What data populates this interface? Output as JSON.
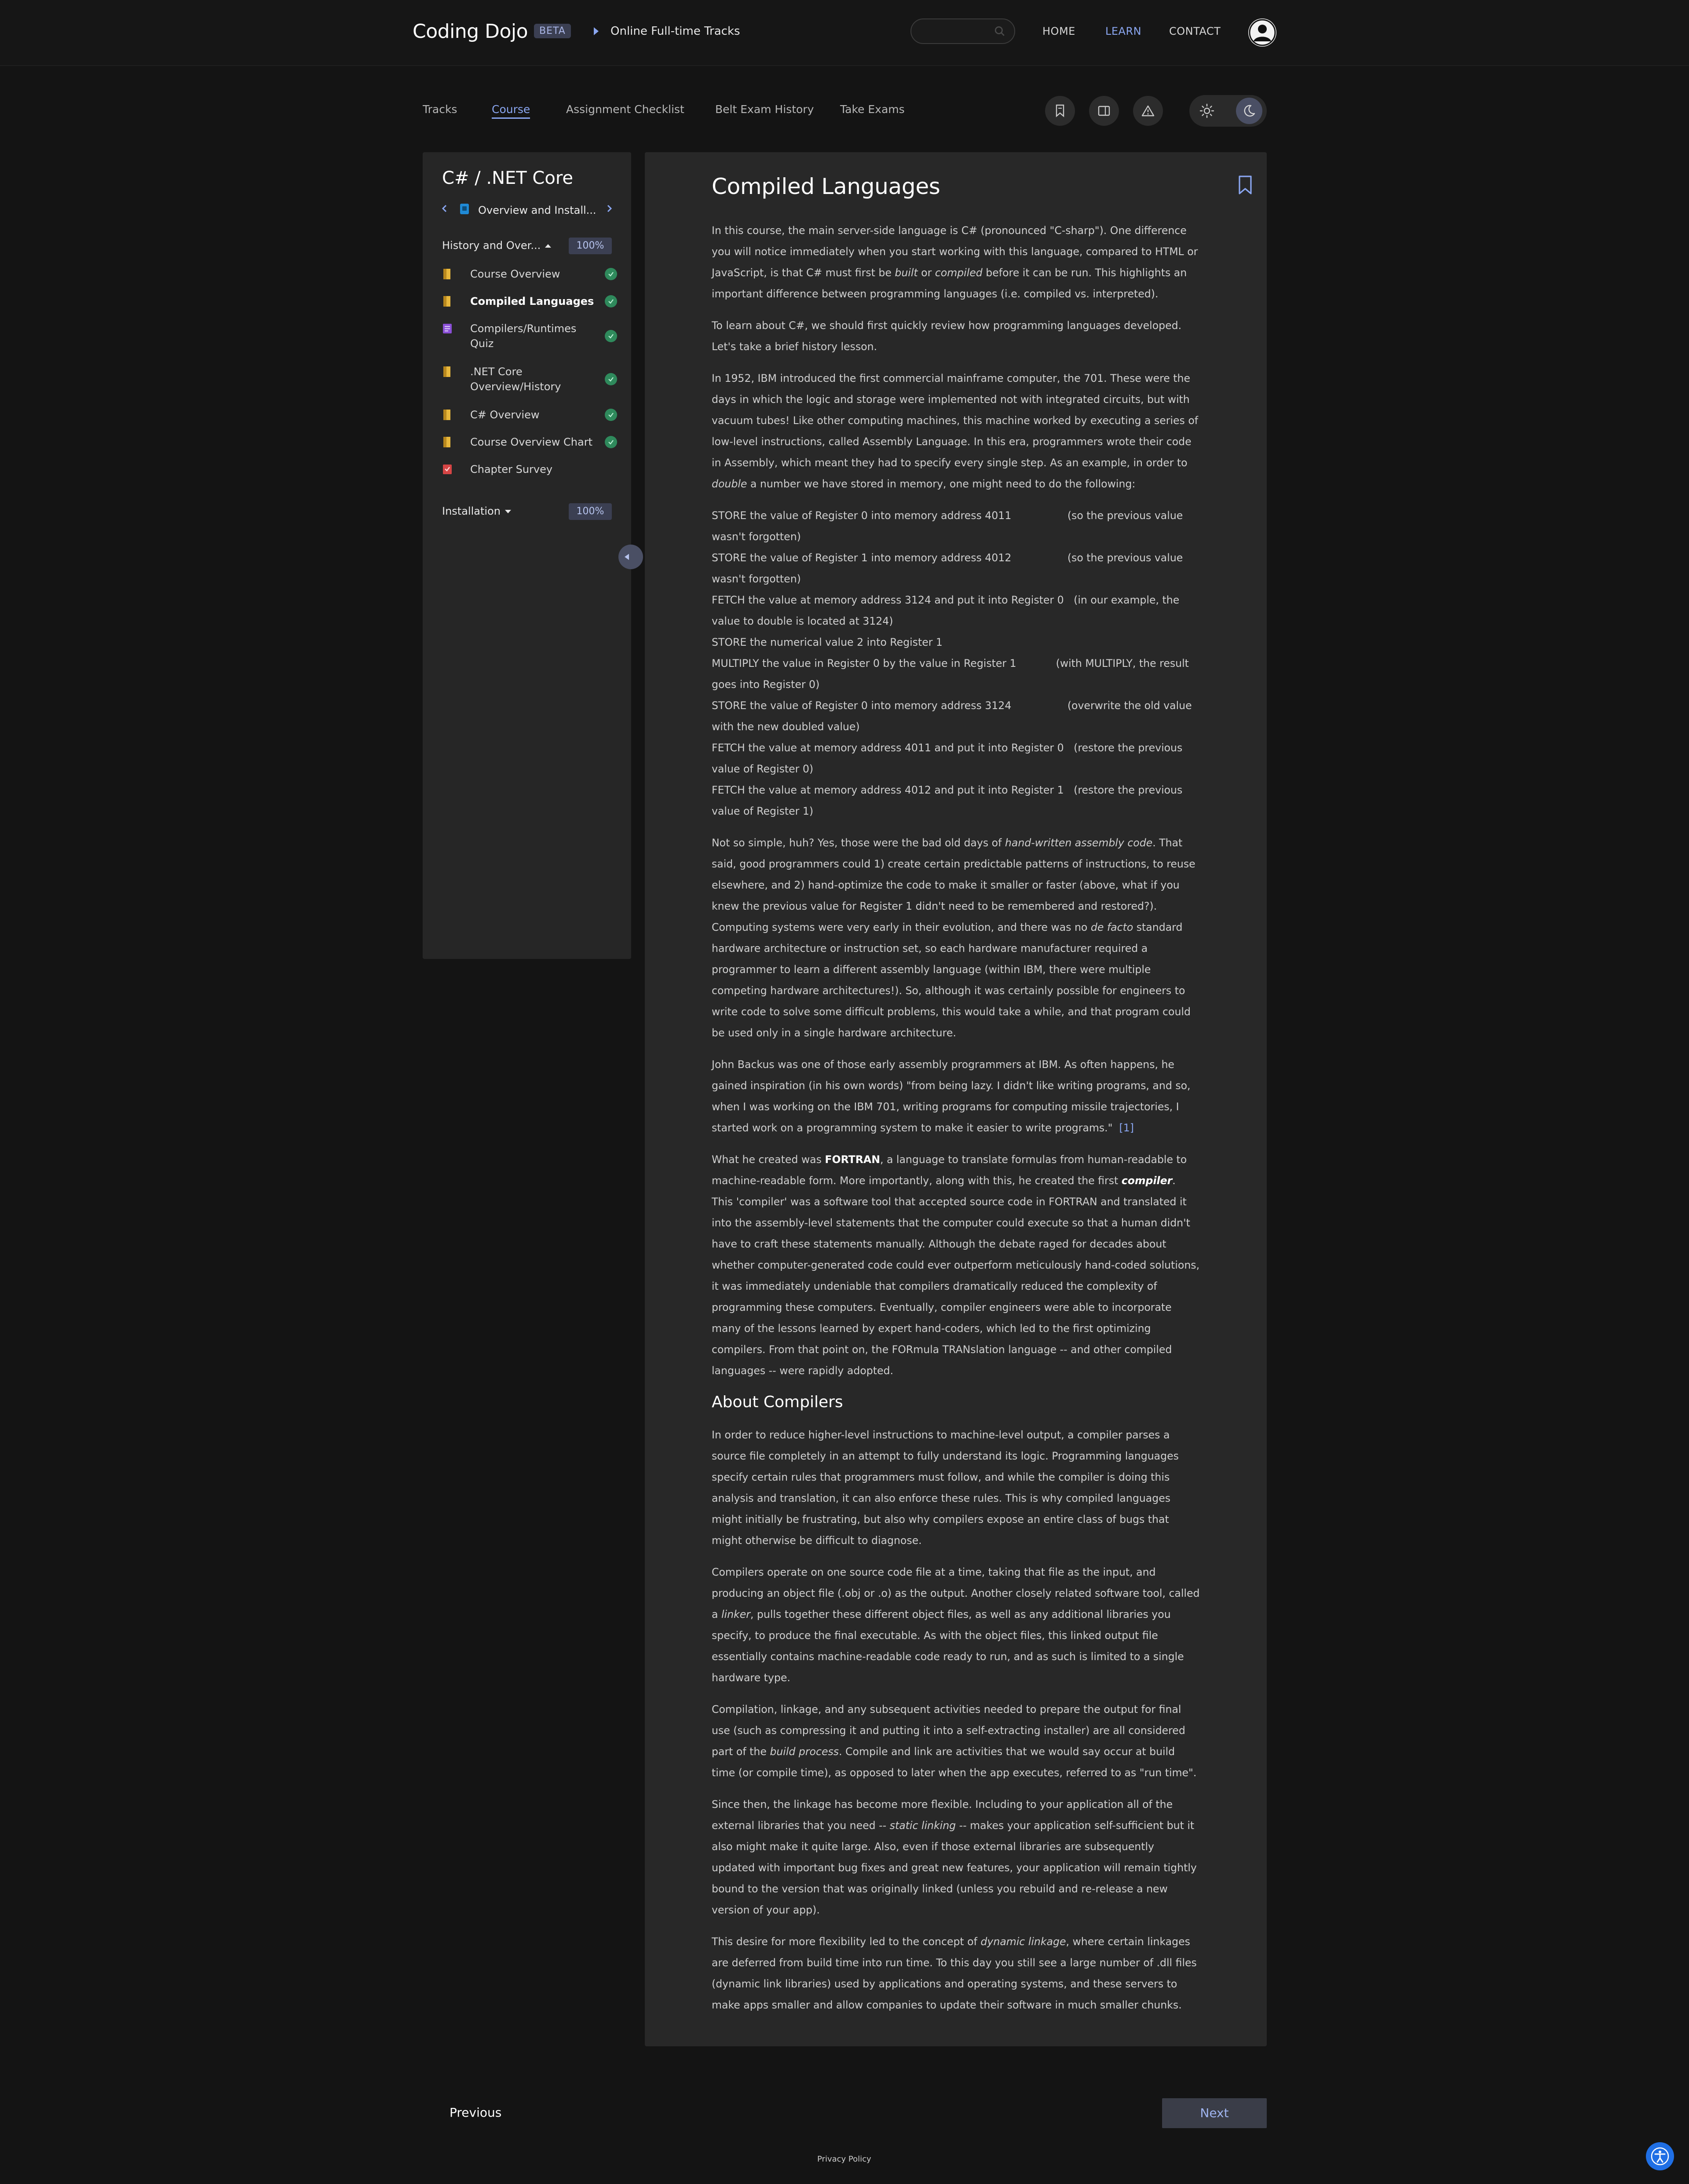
{
  "header": {
    "logo": "Coding Dojo",
    "badge": "BETA",
    "breadcrumb": "Online Full-time Tracks",
    "nav": [
      "HOME",
      "LEARN",
      "CONTACT"
    ],
    "active_nav": "LEARN"
  },
  "tabs": [
    "Tracks",
    "Course",
    "Assignment Checklist",
    "Belt Exam History",
    "Take Exams"
  ],
  "active_tab": "Course",
  "sidebar": {
    "course_title": "C# / .NET Core",
    "chapter": "Overview and Install...",
    "sections": [
      {
        "title": "History and Over...",
        "percent": "100%",
        "items": [
          {
            "label": "Course Overview",
            "icon": "reading-icon"
          },
          {
            "label": "Compiled Languages",
            "icon": "reading-icon"
          },
          {
            "label": "Compilers/Runtimes Quiz",
            "icon": "quiz-icon"
          },
          {
            "label": ".NET Core Overview/History",
            "icon": "reading-icon"
          },
          {
            "label": "C# Overview",
            "icon": "reading-icon"
          },
          {
            "label": "Course Overview Chart",
            "icon": "reading-icon"
          },
          {
            "label": "Chapter Survey",
            "icon": "survey-icon"
          }
        ]
      },
      {
        "title": "Installation",
        "percent": "100%"
      }
    ]
  },
  "colors": {
    "accent": "#8aa6f0",
    "complete": "#2f8a5c",
    "reading": "#e7b73c",
    "quiz": "#8a4fd6",
    "survey": "#d64545"
  },
  "article": {
    "title": "Compiled Languages",
    "p1": [
      "In this course, the main server-side language is C# (pronounced \"C-sharp\"). One difference you will notice immediately when you start working with this language, compared to HTML or JavaScript, is that C# must first be ",
      "built",
      " or ",
      "compiled",
      " before it can be run. This highlights an important difference between programming languages (i.e. compiled vs. interpreted)."
    ],
    "p2": "To learn about C#, we should first quickly review how programming languages developed. Let's take a brief history lesson.",
    "p3": [
      "In 1952, IBM introduced the first commercial mainframe computer, the 701. These were the days in which the logic and storage were implemented not with integrated circuits, but with vacuum tubes! Like other computing machines, this machine worked by executing a series of low-level instructions, called Assembly Language. In this era, programmers wrote their code in Assembly, which meant they had to specify every single step. As an example, in order to ",
      "double",
      " a number we have stored in memory, one might need to do the following:"
    ],
    "steps": [
      "STORE the value of Register 0 into memory address 4011                 (so the previous value wasn't forgotten)",
      "STORE the value of Register 1 into memory address 4012                 (so the previous value wasn't forgotten)",
      "FETCH the value at memory address 3124 and put it into Register 0   (in our example, the value to double is located at 3124)",
      "STORE the numerical value 2 into Register 1",
      "MULTIPLY the value in Register 0 by the value in Register 1            (with MULTIPLY, the result goes into Register 0)",
      "STORE the value of Register 0 into memory address 3124                 (overwrite the old value with the new doubled value)",
      "FETCH the value at memory address 4011 and put it into Register 0   (restore the previous value of Register 0)",
      "FETCH the value at memory address 4012 and put it into Register 1   (restore the previous value of Register 1)"
    ],
    "p4": [
      "Not so simple, huh? Yes, those were the bad old days of ",
      "hand-written assembly code",
      ". That said, good programmers could 1) create certain predictable patterns of instructions, to reuse elsewhere, and 2) hand-optimize the code to make it smaller or faster (above, what if you knew the previous value for Register 1 didn't need to be remembered and restored?). Computing systems were very early in their evolution, and there was no ",
      "de facto",
      " standard hardware architecture or instruction set, so each hardware manufacturer required a programmer to learn a different assembly language (within IBM, there were multiple competing hardware architectures!). So, although it was certainly possible for engineers to write code to solve some difficult problems, this would take a while, and that program could be used only in a single hardware architecture."
    ],
    "p5": "John Backus was one of those early assembly programmers at IBM. As often happens, he gained inspiration (in his own words) \"from being lazy. I didn't like writing programs, and so, when I was working on the IBM 701, writing programs for computing missile trajectories, I started work on a programming system to make it easier to write programs.\"",
    "p5_cite": "[1]",
    "p6": [
      "What he created was ",
      "FORTRAN",
      ", a language to translate formulas from human-readable to machine-readable form. More importantly, along with this, he created the first ",
      "compiler",
      ". This 'compiler' was a software tool that accepted source code in FORTRAN and translated it into the assembly-level statements that the computer could execute so that a human didn't have to craft these statements manually. Although the debate raged for decades about whether computer-generated code could ever outperform meticulously hand-coded solutions, it was immediately undeniable that compilers dramatically reduced the complexity of programming these computers. Eventually, compiler engineers were able to incorporate many of the lessons learned by expert hand-coders, which led to the first optimizing compilers. From that point on, the FORmula TRANslation language -- and other compiled languages -- were rapidly adopted."
    ],
    "h2": "About Compilers",
    "p7": "In order to reduce higher-level instructions to machine-level output, a compiler parses a source file completely in an attempt to fully understand its logic. Programming languages specify certain rules that programmers must follow, and while the compiler is doing this analysis and translation, it can also enforce these rules. This is why compiled languages might initially be frustrating, but also why compilers expose an entire class of bugs that might otherwise be difficult to diagnose.",
    "p8": [
      "Compilers operate on one source code file at a time, taking that file as the input, and producing an object file (.obj or .o) as the output. Another closely related software tool, called a ",
      "linker",
      ", pulls together these different object files, as well as any additional libraries you specify, to produce the final executable. As with the object files, this linked output file essentially contains machine-readable code ready to run, and as such is limited to a single hardware type."
    ],
    "p9": [
      "Compilation, linkage, and any subsequent activities needed to prepare the output for final use (such as compressing it and putting it into a self-extracting installer) are all considered part of the ",
      "build process",
      ". Compile and link are activities that we would say occur at build time (or compile time), as opposed to later when the app executes, referred to as \"run time\"."
    ],
    "p10": [
      "Since then, the linkage has become more flexible. Including to your application all of the external libraries that you need -- ",
      "static linking",
      " -- makes your application self-sufficient but it also might make it quite large. Also, even if those external libraries are subsequently updated with important bug fixes and great new features, your application will remain tightly bound to the version that was originally linked (unless you rebuild and re-release a new version of your app)."
    ],
    "p11": [
      "This desire for more flexibility led to the concept of ",
      "dynamic linkage",
      ", where certain linkages are deferred from build time into run time. To this day you still see a large number of .dll files (dynamic link libraries) used by applications and operating systems, and these servers to make apps smaller and allow companies to update their software in much smaller chunks."
    ]
  },
  "footer": {
    "previous": "Previous",
    "next": "Next",
    "privacy": "Privacy Policy"
  }
}
